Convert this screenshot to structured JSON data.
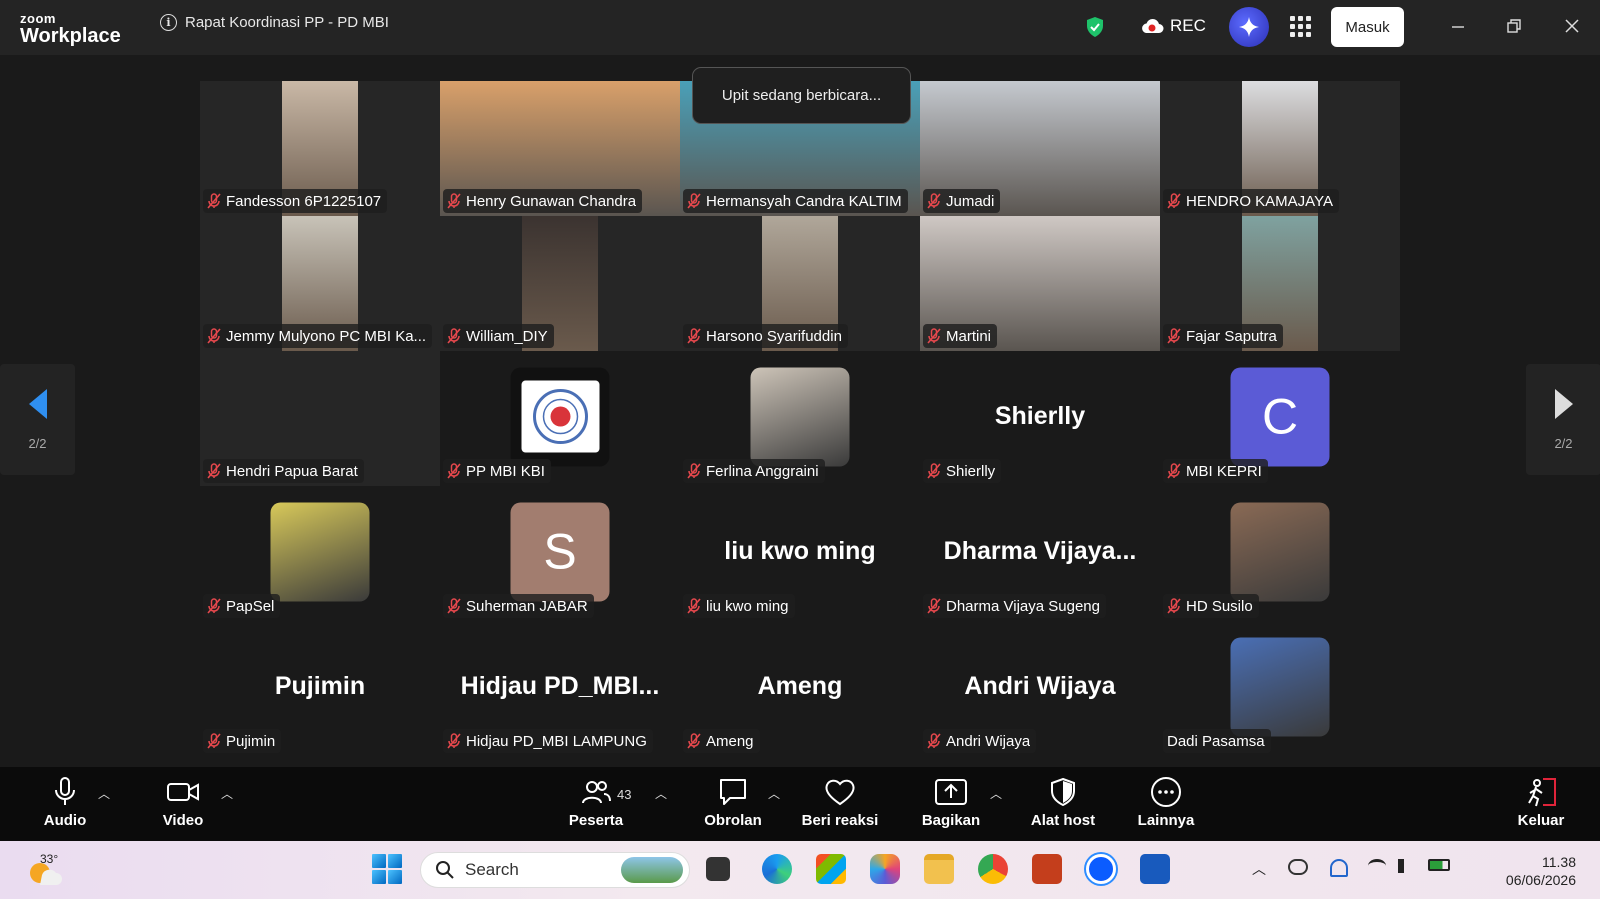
{
  "app": {
    "logo_top": "zoom",
    "logo_bottom": "Workplace",
    "meeting_title": "Rapat Koordinasi PP - PD MBI",
    "rec_label": "REC",
    "signin_label": "Masuk"
  },
  "speaking_toast": "Upit sedang berbicara...",
  "pagination": {
    "left": "2/2",
    "right": "2/2"
  },
  "participants": [
    {
      "name": "Fandesson 6P1225107",
      "kind": "video",
      "color": "#c9b8a6"
    },
    {
      "name": "Henry Gunawan Chandra",
      "kind": "video-full",
      "color": "#d9a06a"
    },
    {
      "name": "Hermansyah Candra KALTIM",
      "kind": "video-full",
      "color": "#4aa0b8"
    },
    {
      "name": "Jumadi",
      "kind": "video-full",
      "color": "#c5c9cf"
    },
    {
      "name": "HENDRO KAMAJAYA",
      "kind": "video",
      "color": "#dcdde0"
    },
    {
      "name": "Jemmy Mulyono PC MBI Ka...",
      "kind": "video",
      "color": "#c8c3b8"
    },
    {
      "name": "William_DIY",
      "kind": "video",
      "color": "#3b3330"
    },
    {
      "name": "Harsono Syarifuddin",
      "kind": "video",
      "color": "#b0a79a"
    },
    {
      "name": "Martini",
      "kind": "video-full",
      "color": "#cfc8c4"
    },
    {
      "name": "Fajar Saputra",
      "kind": "video",
      "color": "#7fa2a0"
    },
    {
      "name": "Hendri Papua Barat",
      "kind": "blank"
    },
    {
      "name": "PP MBI KBI",
      "kind": "avatar-logo",
      "color": "#ffffff"
    },
    {
      "name": "Ferlina Anggraini",
      "kind": "avatar-photo",
      "color": "#cdc4b8"
    },
    {
      "name": "Shierlly",
      "kind": "text",
      "big": "Shierlly"
    },
    {
      "name": "MBI KEPRI",
      "kind": "letter",
      "letter": "C",
      "color": "#5b5bd6"
    },
    {
      "name": "PapSel",
      "kind": "avatar-photo",
      "color": "#d8c95a"
    },
    {
      "name": "Suherman JABAR",
      "kind": "letter",
      "letter": "S",
      "color": "#a27d6f"
    },
    {
      "name": "liu kwo ming",
      "kind": "text",
      "big": "liu kwo ming"
    },
    {
      "name": "Dharma Vijaya Sugeng",
      "kind": "text",
      "big": "Dharma  Vijaya..."
    },
    {
      "name": "HD Susilo",
      "kind": "avatar-photo",
      "color": "#8a6a55"
    },
    {
      "name": "Pujimin",
      "kind": "text",
      "big": "Pujimin"
    },
    {
      "name": "Hidjau PD_MBI LAMPUNG",
      "kind": "text",
      "big": "Hidjau  PD_MBI..."
    },
    {
      "name": "Ameng",
      "kind": "text",
      "big": "Ameng"
    },
    {
      "name": "Andri Wijaya",
      "kind": "text",
      "big": "Andri Wijaya"
    },
    {
      "name": "Dadi Pasamsa",
      "kind": "avatar-photo",
      "color": "#4a6fb5",
      "unmuted": true
    }
  ],
  "toolbar": {
    "audio": "Audio",
    "video": "Video",
    "participants": "Peserta",
    "participants_count": "43",
    "chat": "Obrolan",
    "react": "Beri reaksi",
    "share": "Bagikan",
    "host_tools": "Alat host",
    "more": "Lainnya",
    "leave": "Keluar"
  },
  "taskbar": {
    "temperature": "33°",
    "search_placeholder": "Search",
    "time": "11.38",
    "date": "06/06/2026"
  }
}
